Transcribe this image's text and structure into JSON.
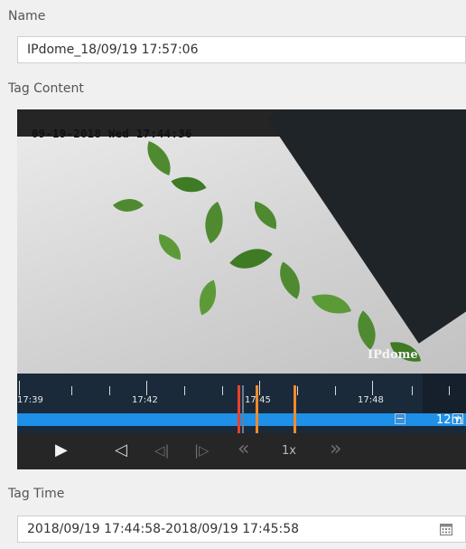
{
  "name_label": "Name",
  "name_value": "IPdome_18/09/19 17:57:06",
  "tag_content_label": "Tag Content",
  "video": {
    "timestamp": "09-19-2018 Wed 17:44:36",
    "camera_name": "IPdome"
  },
  "timeline": {
    "tick_labels": [
      "17:39",
      "17:42",
      "17:45",
      "17:48"
    ],
    "zoom_minus": "−",
    "zoom_plus": "+",
    "zoom_level": "12m",
    "colors": {
      "current": "#e8412a",
      "clip_marker": "#f08a2a",
      "band": "#1e90e8"
    }
  },
  "controls": {
    "play": "▶",
    "reverse": "◁",
    "step_back": "◁|",
    "step_forward": "|▷",
    "slower": "«",
    "speed": "1x",
    "faster": "»"
  },
  "tag_time_label": "Tag Time",
  "tag_time_value": "2018/09/19 17:44:58-2018/09/19 17:45:58",
  "calendar_icon": "calendar-icon"
}
